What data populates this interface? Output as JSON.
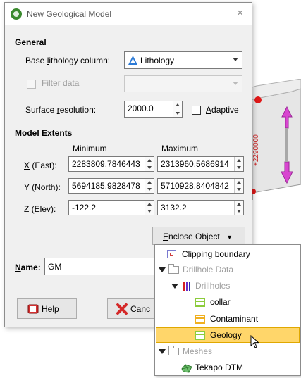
{
  "dialog": {
    "title": "New Geological Model",
    "close_glyph": "×",
    "general_heading": "General",
    "base_lithology_label_pre": "Base ",
    "base_lithology_label_ul": "l",
    "base_lithology_label_post": "ithology column:",
    "base_lithology_value": "Lithology",
    "filter_data_ul": "F",
    "filter_data_post": "ilter data",
    "surface_resolution_pre": "Surface ",
    "surface_resolution_ul": "r",
    "surface_resolution_post": "esolution:",
    "surface_resolution_value": "2000.0",
    "adaptive_ul": "A",
    "adaptive_post": "daptive",
    "model_extents_heading": "Model Extents",
    "minimum_header": "Minimum",
    "maximum_header": "Maximum",
    "rows": [
      {
        "label_ul": "X",
        "label_post": " (East):",
        "min": "2283809.7846443",
        "max": "2313960.5686914"
      },
      {
        "label_ul": "Y",
        "label_post": " (North):",
        "min": "5694185.9828478",
        "max": "5710928.8404842"
      },
      {
        "label_ul": "Z",
        "label_post": " (Elev):",
        "min": "-122.2",
        "max": "3132.2"
      }
    ],
    "enclose_object_ul": "E",
    "enclose_object_post": "nclose Object",
    "enclose_arrow": "▼",
    "name_label_ul": "N",
    "name_label_post": "ame:",
    "name_value": "GM",
    "help_ul": "H",
    "help_post": "elp",
    "cancel_visible": "Canc"
  },
  "scene": {
    "axis_label": "+2290000"
  },
  "menu": {
    "items": [
      {
        "label": "Clipping boundary"
      },
      {
        "label": "Drillhole Data"
      },
      {
        "label": "Drillholes"
      },
      {
        "label": "collar"
      },
      {
        "label": "Contaminant"
      },
      {
        "label": "Geology"
      },
      {
        "label": "Meshes"
      },
      {
        "label": "Tekapo DTM"
      }
    ]
  }
}
